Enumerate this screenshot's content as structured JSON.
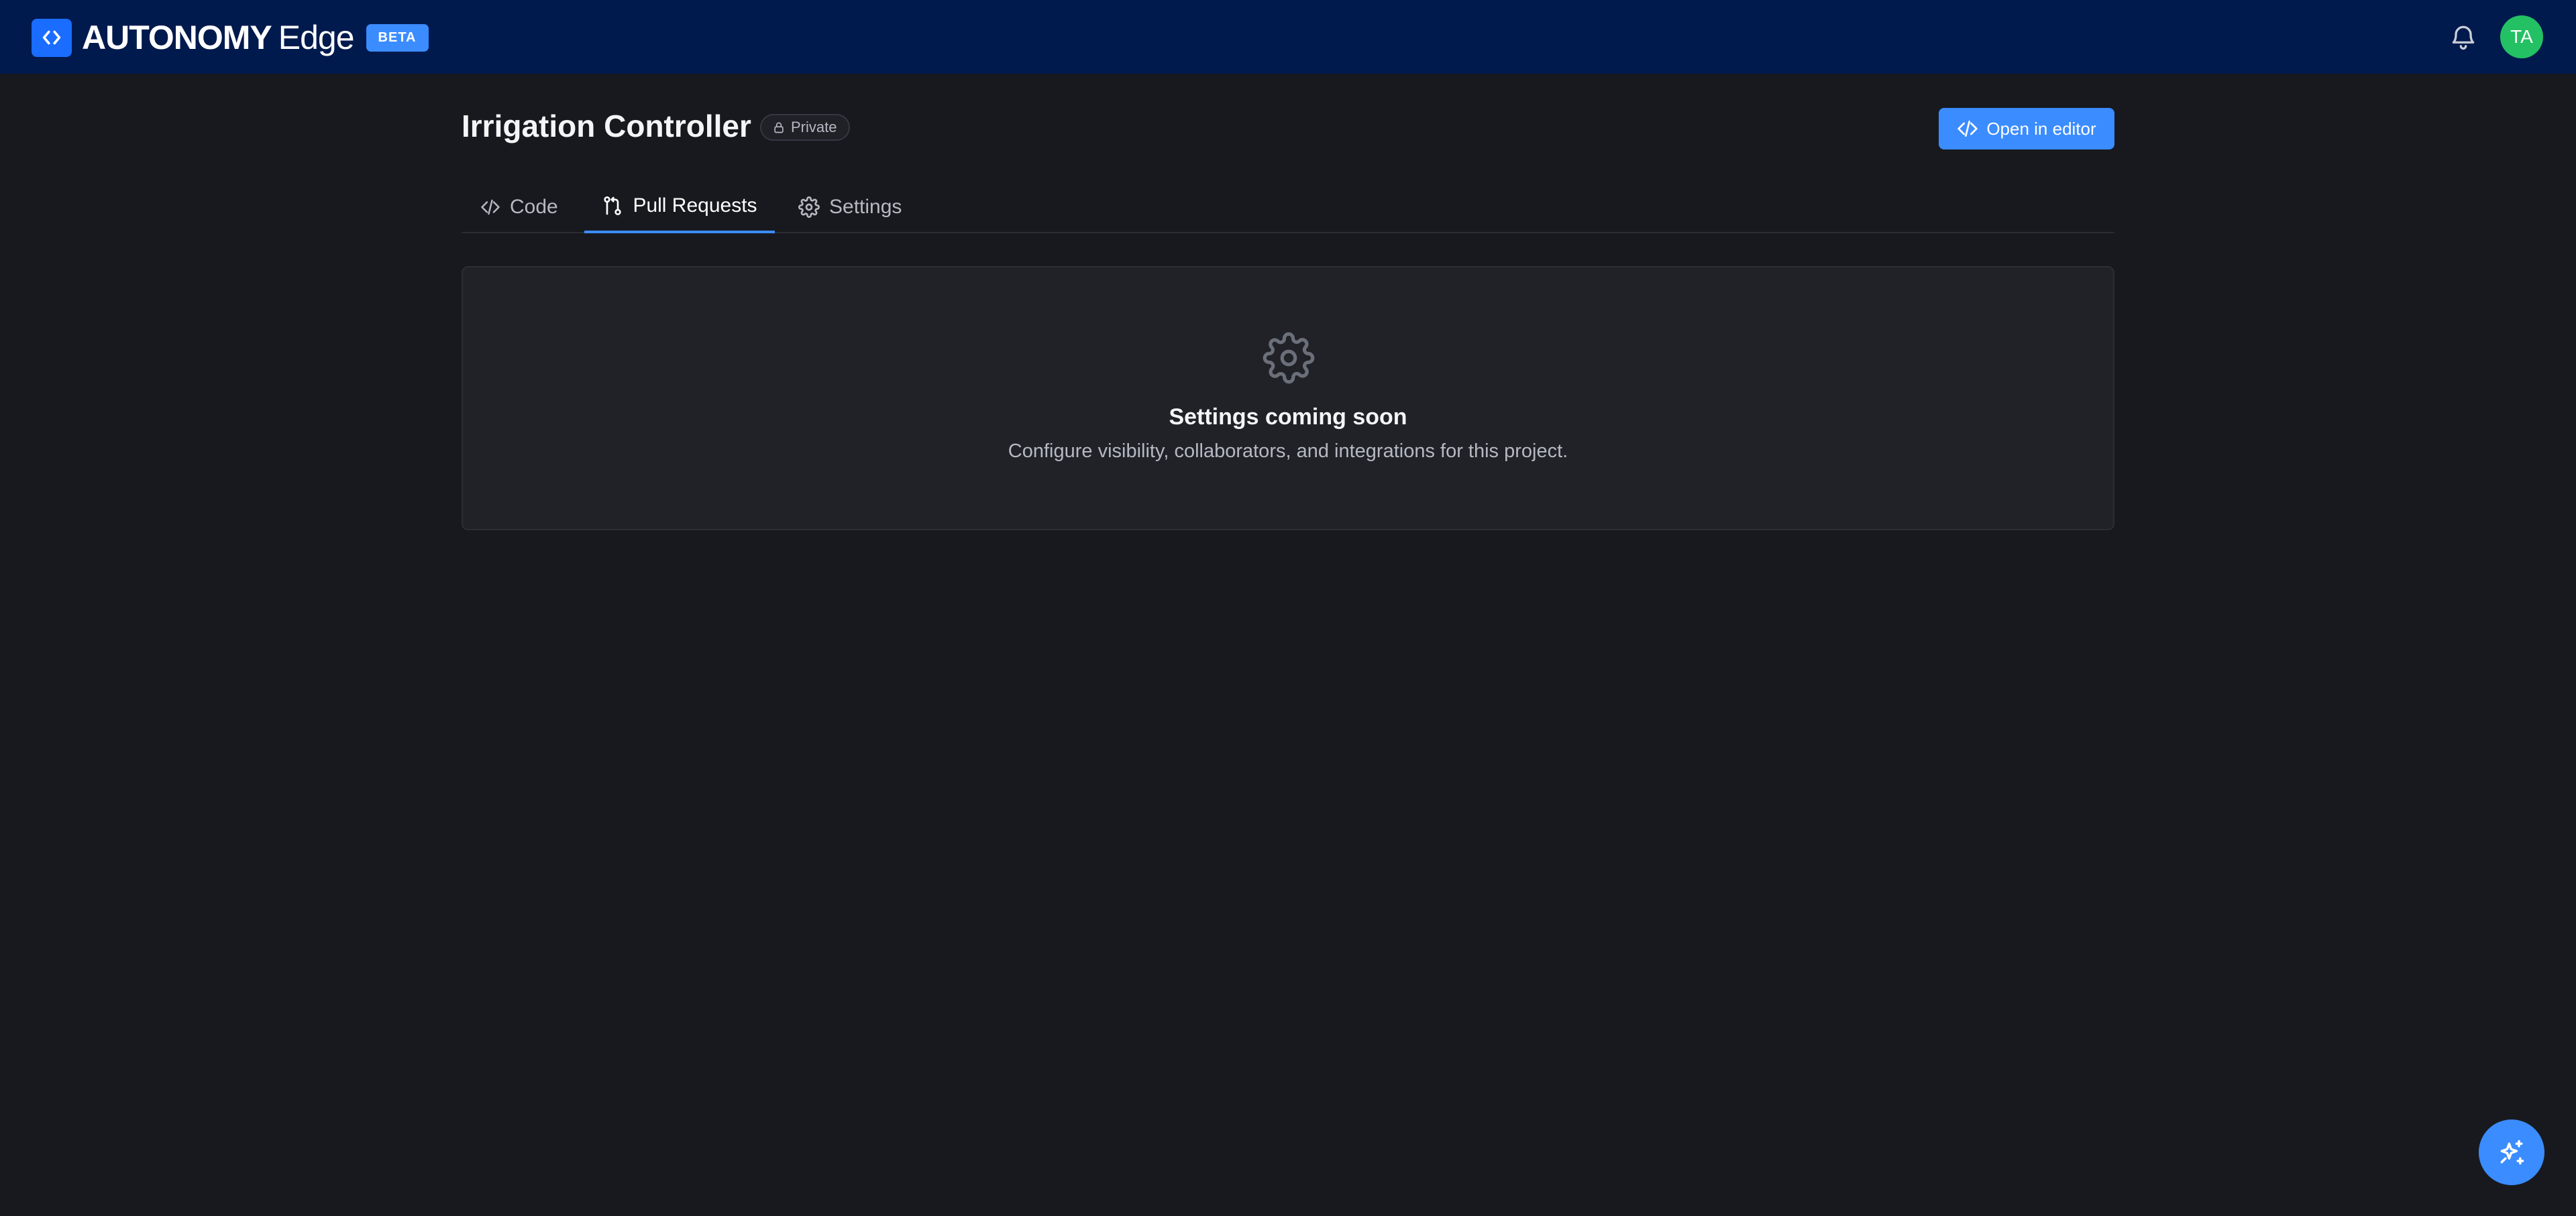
{
  "header": {
    "brand_name": "AUTONOMY",
    "brand_sub": "Edge",
    "beta_label": "BETA",
    "avatar_initials": "TA",
    "colors": {
      "background": "#001a4d",
      "logo": "#1a6dff",
      "avatar": "#23c163"
    },
    "icons": [
      "code-icon",
      "bell-icon"
    ]
  },
  "project": {
    "title": "Irrigation Controller",
    "visibility_label": "Private",
    "open_editor_label": "Open in editor"
  },
  "tabs": [
    {
      "label": "Code",
      "icon": "code-icon",
      "active": false
    },
    {
      "label": "Pull Requests",
      "icon": "git-pull-request-icon",
      "active": true
    },
    {
      "label": "Settings",
      "icon": "gear-icon",
      "active": false
    }
  ],
  "panel": {
    "icon": "gear-icon",
    "title": "Settings coming soon",
    "description": "Configure visibility, collaborators, and integrations for this project."
  },
  "fab": {
    "icon": "sparkles-icon"
  },
  "colors": {
    "accent": "#3b8cff",
    "page_background": "#18191e",
    "panel_background": "#202228"
  }
}
